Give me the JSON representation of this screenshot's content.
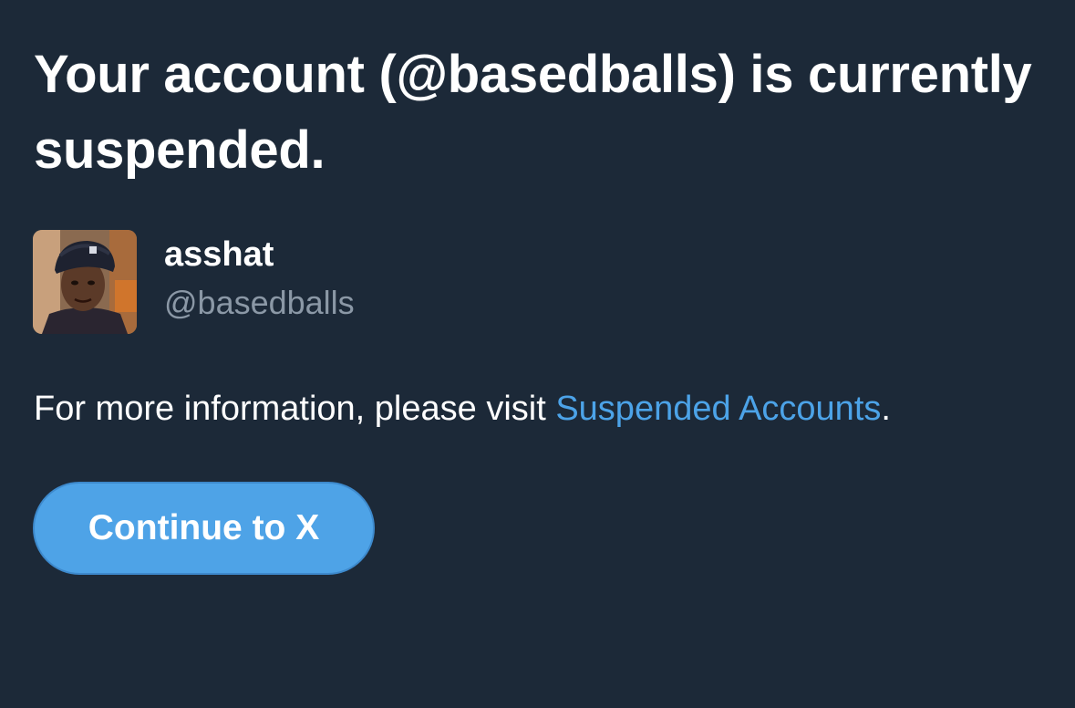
{
  "screen": {
    "title": "Your account (@basedballs) is currently suspended."
  },
  "profile": {
    "display_name": "asshat",
    "handle": "@basedballs",
    "avatar": "profile-photo"
  },
  "info": {
    "text_before": "For more information, please visit ",
    "link_label": "Suspended Accounts",
    "text_after": "."
  },
  "actions": {
    "continue_label": "Continue to X"
  },
  "colors": {
    "background": "#1c2938",
    "primary_text": "#ffffff",
    "secondary_text": "#8b98a6",
    "link": "#4ca3e8",
    "button_fill": "#4ea3e7"
  }
}
